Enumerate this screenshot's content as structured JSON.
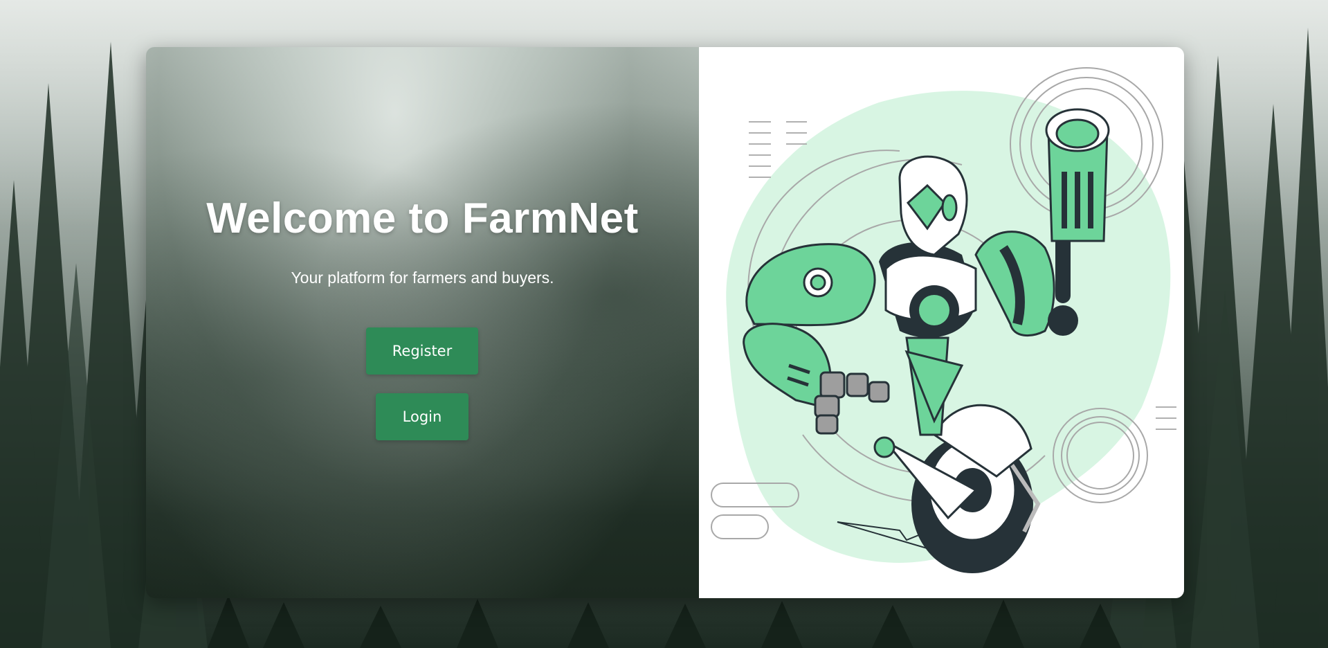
{
  "hero": {
    "title": "Welcome to FarmNet",
    "subtitle": "Your platform for farmers and buyers."
  },
  "actions": {
    "register_label": "Register",
    "login_label": "Login"
  },
  "illustration": {
    "subject": "robot-on-wheel-illustration"
  },
  "background": {
    "subject": "misty-forest-background"
  },
  "colors": {
    "button": "#2e8b57",
    "accent_green": "#6dd49a",
    "light_green": "#d8f5e3",
    "dark": "#263238"
  }
}
